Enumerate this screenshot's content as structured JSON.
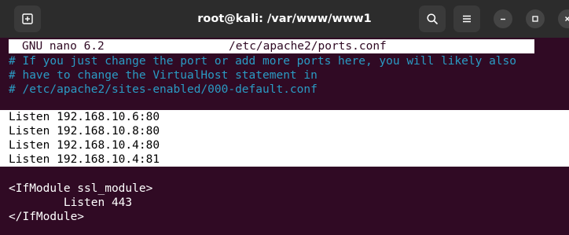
{
  "window": {
    "title": "root@kali: /var/www/www1"
  },
  "icons": {
    "new_tab": "new-tab-icon",
    "search": "search-icon",
    "menu": "hamburger-menu-icon",
    "minimize": "minimize-icon",
    "maximize": "maximize-icon",
    "close": "close-icon"
  },
  "nano": {
    "version": "GNU nano 6.2",
    "filename": "/etc/apache2/ports.conf"
  },
  "lines": {
    "comment1": "# If you just change the port or add more ports here, you will likely also",
    "comment2": "# have to change the VirtualHost statement in",
    "comment3": "# /etc/apache2/sites-enabled/000-default.conf",
    "listen1": "Listen 192.168.10.6:80",
    "listen2": "Listen 192.168.10.8:80",
    "listen3": "Listen 192.168.10.4:80",
    "listen4": "Listen 192.168.10.4:81",
    "ifmodule_open": "<IfModule ssl_module>",
    "listen_ssl": "        Listen 443",
    "ifmodule_close": "</IfModule>"
  },
  "colors": {
    "terminal_bg": "#300a24",
    "titlebar_bg": "#2c2c2c",
    "comment": "#2a9bc4",
    "text": "#ffffff",
    "selection_bg": "#ffffff"
  }
}
